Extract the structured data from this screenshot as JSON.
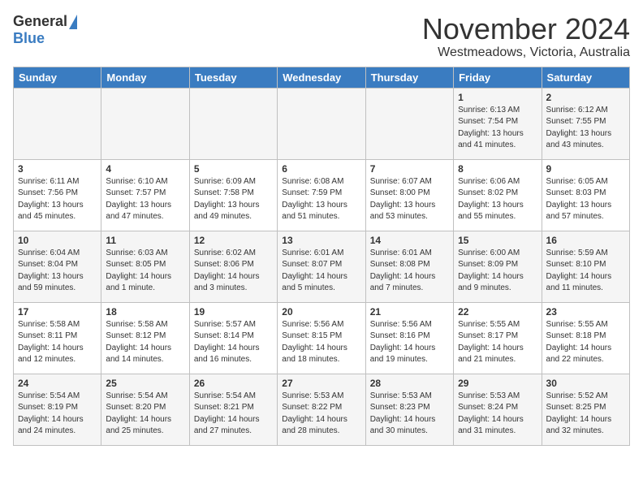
{
  "header": {
    "logo_general": "General",
    "logo_blue": "Blue",
    "month_title": "November 2024",
    "location": "Westmeadows, Victoria, Australia"
  },
  "weekdays": [
    "Sunday",
    "Monday",
    "Tuesday",
    "Wednesday",
    "Thursday",
    "Friday",
    "Saturday"
  ],
  "weeks": [
    [
      {
        "day": "",
        "info": ""
      },
      {
        "day": "",
        "info": ""
      },
      {
        "day": "",
        "info": ""
      },
      {
        "day": "",
        "info": ""
      },
      {
        "day": "",
        "info": ""
      },
      {
        "day": "1",
        "info": "Sunrise: 6:13 AM\nSunset: 7:54 PM\nDaylight: 13 hours\nand 41 minutes."
      },
      {
        "day": "2",
        "info": "Sunrise: 6:12 AM\nSunset: 7:55 PM\nDaylight: 13 hours\nand 43 minutes."
      }
    ],
    [
      {
        "day": "3",
        "info": "Sunrise: 6:11 AM\nSunset: 7:56 PM\nDaylight: 13 hours\nand 45 minutes."
      },
      {
        "day": "4",
        "info": "Sunrise: 6:10 AM\nSunset: 7:57 PM\nDaylight: 13 hours\nand 47 minutes."
      },
      {
        "day": "5",
        "info": "Sunrise: 6:09 AM\nSunset: 7:58 PM\nDaylight: 13 hours\nand 49 minutes."
      },
      {
        "day": "6",
        "info": "Sunrise: 6:08 AM\nSunset: 7:59 PM\nDaylight: 13 hours\nand 51 minutes."
      },
      {
        "day": "7",
        "info": "Sunrise: 6:07 AM\nSunset: 8:00 PM\nDaylight: 13 hours\nand 53 minutes."
      },
      {
        "day": "8",
        "info": "Sunrise: 6:06 AM\nSunset: 8:02 PM\nDaylight: 13 hours\nand 55 minutes."
      },
      {
        "day": "9",
        "info": "Sunrise: 6:05 AM\nSunset: 8:03 PM\nDaylight: 13 hours\nand 57 minutes."
      }
    ],
    [
      {
        "day": "10",
        "info": "Sunrise: 6:04 AM\nSunset: 8:04 PM\nDaylight: 13 hours\nand 59 minutes."
      },
      {
        "day": "11",
        "info": "Sunrise: 6:03 AM\nSunset: 8:05 PM\nDaylight: 14 hours\nand 1 minute."
      },
      {
        "day": "12",
        "info": "Sunrise: 6:02 AM\nSunset: 8:06 PM\nDaylight: 14 hours\nand 3 minutes."
      },
      {
        "day": "13",
        "info": "Sunrise: 6:01 AM\nSunset: 8:07 PM\nDaylight: 14 hours\nand 5 minutes."
      },
      {
        "day": "14",
        "info": "Sunrise: 6:01 AM\nSunset: 8:08 PM\nDaylight: 14 hours\nand 7 minutes."
      },
      {
        "day": "15",
        "info": "Sunrise: 6:00 AM\nSunset: 8:09 PM\nDaylight: 14 hours\nand 9 minutes."
      },
      {
        "day": "16",
        "info": "Sunrise: 5:59 AM\nSunset: 8:10 PM\nDaylight: 14 hours\nand 11 minutes."
      }
    ],
    [
      {
        "day": "17",
        "info": "Sunrise: 5:58 AM\nSunset: 8:11 PM\nDaylight: 14 hours\nand 12 minutes."
      },
      {
        "day": "18",
        "info": "Sunrise: 5:58 AM\nSunset: 8:12 PM\nDaylight: 14 hours\nand 14 minutes."
      },
      {
        "day": "19",
        "info": "Sunrise: 5:57 AM\nSunset: 8:14 PM\nDaylight: 14 hours\nand 16 minutes."
      },
      {
        "day": "20",
        "info": "Sunrise: 5:56 AM\nSunset: 8:15 PM\nDaylight: 14 hours\nand 18 minutes."
      },
      {
        "day": "21",
        "info": "Sunrise: 5:56 AM\nSunset: 8:16 PM\nDaylight: 14 hours\nand 19 minutes."
      },
      {
        "day": "22",
        "info": "Sunrise: 5:55 AM\nSunset: 8:17 PM\nDaylight: 14 hours\nand 21 minutes."
      },
      {
        "day": "23",
        "info": "Sunrise: 5:55 AM\nSunset: 8:18 PM\nDaylight: 14 hours\nand 22 minutes."
      }
    ],
    [
      {
        "day": "24",
        "info": "Sunrise: 5:54 AM\nSunset: 8:19 PM\nDaylight: 14 hours\nand 24 minutes."
      },
      {
        "day": "25",
        "info": "Sunrise: 5:54 AM\nSunset: 8:20 PM\nDaylight: 14 hours\nand 25 minutes."
      },
      {
        "day": "26",
        "info": "Sunrise: 5:54 AM\nSunset: 8:21 PM\nDaylight: 14 hours\nand 27 minutes."
      },
      {
        "day": "27",
        "info": "Sunrise: 5:53 AM\nSunset: 8:22 PM\nDaylight: 14 hours\nand 28 minutes."
      },
      {
        "day": "28",
        "info": "Sunrise: 5:53 AM\nSunset: 8:23 PM\nDaylight: 14 hours\nand 30 minutes."
      },
      {
        "day": "29",
        "info": "Sunrise: 5:53 AM\nSunset: 8:24 PM\nDaylight: 14 hours\nand 31 minutes."
      },
      {
        "day": "30",
        "info": "Sunrise: 5:52 AM\nSunset: 8:25 PM\nDaylight: 14 hours\nand 32 minutes."
      }
    ]
  ]
}
